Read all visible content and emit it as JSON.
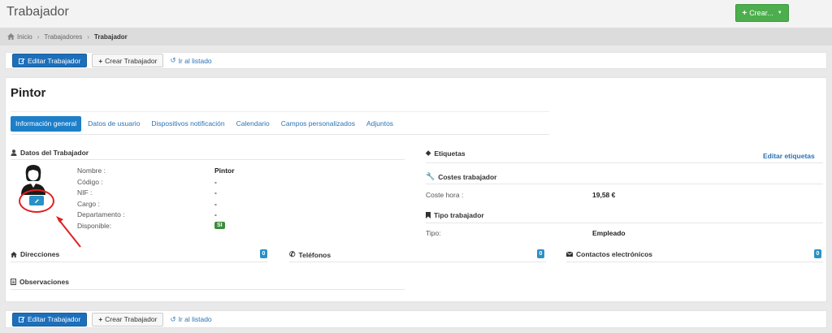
{
  "header": {
    "title": "Trabajador",
    "create_button": "Crear..."
  },
  "breadcrumb": {
    "home": "Inicio",
    "workers": "Trabajadores",
    "current": "Trabajador"
  },
  "toolbar": {
    "edit": "Editar Trabajador",
    "create": "Crear Trabajador",
    "list": "Ir al listado"
  },
  "worker": {
    "name": "Pintor"
  },
  "tabs": [
    "Información general",
    "Datos de usuario",
    "Dispositivos notificación",
    "Calendario",
    "Campos personalizados",
    "Adjuntos"
  ],
  "datos": {
    "title": "Datos del Trabajador",
    "fields": [
      {
        "label": "Nombre :",
        "value": "Pintor"
      },
      {
        "label": "Código :",
        "value": "-"
      },
      {
        "label": "NIF :",
        "value": "-"
      },
      {
        "label": "Cargo :",
        "value": "-"
      },
      {
        "label": "Departamento :",
        "value": "-"
      },
      {
        "label": "Disponible:",
        "value": "SI"
      }
    ]
  },
  "sections": {
    "direcciones": {
      "title": "Direcciones",
      "count": "0"
    },
    "telefonos": {
      "title": "Teléfonos",
      "count": "0"
    },
    "contactos": {
      "title": "Contactos electrónicos",
      "count": "0"
    },
    "observaciones": {
      "title": "Observaciones"
    }
  },
  "right": {
    "etiquetas": "Etiquetas",
    "edit_tags": "Editar etiquetas",
    "costes_title": "Costes trabajador",
    "coste_label": "Coste hora :",
    "coste_value": "19,58 €",
    "tipo_title": "Tipo trabajador",
    "tipo_label": "Tipo:",
    "tipo_value": "Empleado"
  },
  "colors": {
    "primary": "#1d6fba",
    "success": "#4cae4c",
    "link": "#2a73b8",
    "highlight": "#e02020"
  }
}
